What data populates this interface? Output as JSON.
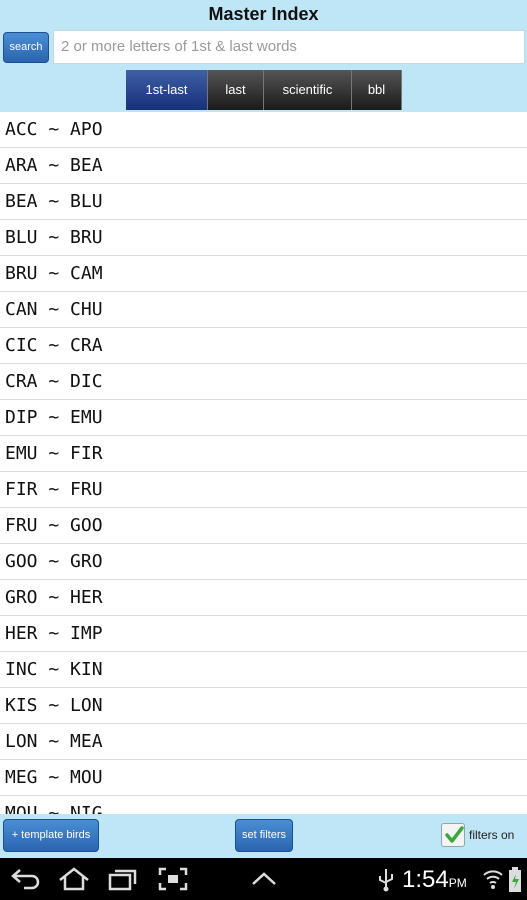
{
  "title": "Master Index",
  "search": {
    "button_label": "search",
    "placeholder": "2 or more letters of 1st & last words"
  },
  "tabs": [
    {
      "label": "1st-last",
      "active": true
    },
    {
      "label": "last",
      "active": false
    },
    {
      "label": "scientific",
      "active": false
    },
    {
      "label": "bbl",
      "active": false
    }
  ],
  "index_rows": [
    "ACC ~ APO",
    "ARA ~ BEA",
    "BEA ~ BLU",
    "BLU ~ BRU",
    "BRU ~ CAM",
    "CAN ~ CHU",
    "CIC ~ CRA",
    "CRA ~ DIC",
    "DIP ~ EMU",
    "EMU ~ FIR",
    "FIR ~ FRU",
    "FRU ~ GOO",
    "GOO ~ GRO",
    "GRO ~ HER",
    "HER ~ IMP",
    "INC ~ KIN",
    "KIS ~ LON",
    "LON ~ MEA",
    "MEG ~ MOU",
    "MOU ~ NIG"
  ],
  "footer": {
    "template_button": "+ template birds",
    "filters_button": "set filters",
    "filters_on_label": "filters on",
    "filters_on_checked": true
  },
  "status_bar": {
    "time": "1:54",
    "ampm": "PM",
    "icons": [
      "back-icon",
      "home-icon",
      "recent-apps-icon",
      "screenshot-icon",
      "up-arrow-icon",
      "usb-icon",
      "wifi-icon",
      "battery-icon"
    ]
  },
  "colors": {
    "header_bg": "#bfe6f7",
    "button_blue": "#2b64b0",
    "active_tab": "#17307a"
  }
}
